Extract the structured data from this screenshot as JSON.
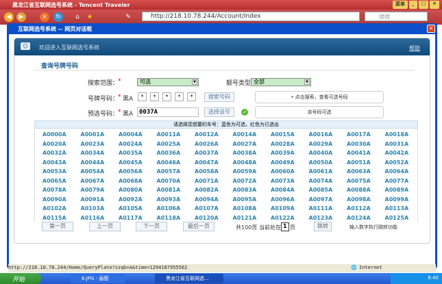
{
  "browser": {
    "title": "黑龙江省互联网选号系统 - Tencent Traveler",
    "url": "http://218.10.78.244/Account/Index",
    "search_placeholder": "搜搜",
    "menu_label": "菜单"
  },
  "dialog": {
    "title": "互联网选号系统 -- 网页对话框",
    "close": "×"
  },
  "panel": {
    "welcome": "欢迎进入互联网选号系统",
    "help": "帮助",
    "section_title": "查询号牌号码"
  },
  "form": {
    "range_label": "搜索范围：",
    "range_value": "可选",
    "type_label": "靓号类型：",
    "type_value": "全部",
    "plate_label": "号牌号码：",
    "prefix": "黑A",
    "plate_chars": [
      "*",
      "*",
      "*",
      "*",
      "*"
    ],
    "search_button": "搜索号码",
    "search_tip": "• 点击搜索，查看可选号码",
    "pre_label": "预选号码：",
    "pre_value": "0037A",
    "select_button": "选择该号",
    "select_tip": "该号码可选",
    "required": "*"
  },
  "grid": {
    "header": "请选择您想要的车号：蓝色为可选，红色为已选出",
    "rows": [
      [
        "A0000A",
        "A0001A",
        "A0004A",
        "A0011A",
        "A0012A",
        "A0014A",
        "A0015A",
        "A0016A",
        "A0017A",
        "A0018A"
      ],
      [
        "A0020A",
        "A0023A",
        "A0024A",
        "A0025A",
        "A0026A",
        "A0027A",
        "A0028A",
        "A0029A",
        "A0030A",
        "A0031A"
      ],
      [
        "A0032A",
        "A0034A",
        "A0035A",
        "A0036A",
        "A0037A",
        "A0038A",
        "A0039A",
        "A0040A",
        "A0041A",
        "A0042A"
      ],
      [
        "A0043A",
        "A0044A",
        "A0045A",
        "A0046A",
        "A0047A",
        "A0048A",
        "A0049A",
        "A0050A",
        "A0051A",
        "A0052A"
      ],
      [
        "A0053A",
        "A0054A",
        "A0056A",
        "A0057A",
        "A0058A",
        "A0059A",
        "A0060A",
        "A0061A",
        "A0063A",
        "A0064A"
      ],
      [
        "A0065A",
        "A0067A",
        "A0068A",
        "A0070A",
        "A0071A",
        "A0072A",
        "A0073A",
        "A0074A",
        "A0075A",
        "A0077A"
      ],
      [
        "A0078A",
        "A0079A",
        "A0080A",
        "A0081A",
        "A0082A",
        "A0083A",
        "A0084A",
        "A0085A",
        "A0088A",
        "A0089A"
      ],
      [
        "A0090A",
        "A0091A",
        "A0092A",
        "A0093A",
        "A0094A",
        "A0095A",
        "A0096A",
        "A0097A",
        "A0098A",
        "A0099A"
      ],
      [
        "A0102A",
        "A0103A",
        "A0105A",
        "A0106A",
        "A0107A",
        "A0108A",
        "A0109A",
        "A0111A",
        "A0112A",
        "A0113A"
      ],
      [
        "A0115A",
        "A0116A",
        "A0117A",
        "A0118A",
        "A0120A",
        "A0121A",
        "A0122A",
        "A0123A",
        "A0124A",
        "A0125A"
      ]
    ]
  },
  "pager": {
    "first": "第一页",
    "prev": "上一页",
    "next": "下一页",
    "last": "最后一页",
    "total": "共100页",
    "current_prefix": "当前处在",
    "current_page": "1",
    "page_suffix": "页",
    "jump": "跳转",
    "jump_hint": "输入数字执行跳转功能"
  },
  "status": {
    "url": "http://218.10.78.244/Home/QueryPlate?zzqb=A&time=1294187955562",
    "zone": "Internet"
  },
  "taskbar": {
    "start": "开始",
    "tasks": [
      "6.JPG - 画图",
      "黑龙江省互联网选..."
    ],
    "clock": "8:40"
  }
}
